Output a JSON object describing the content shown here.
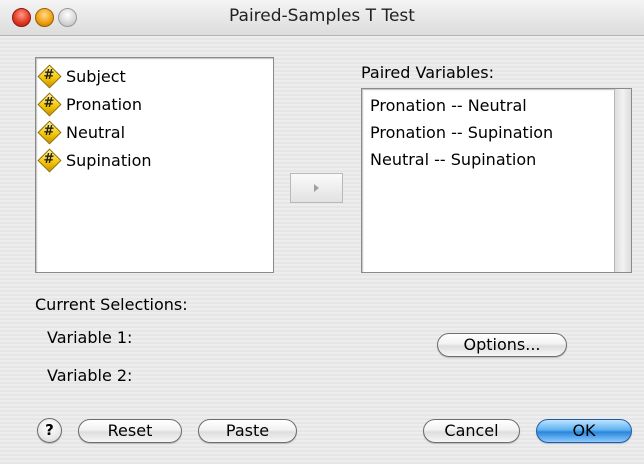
{
  "window": {
    "title": "Paired-Samples T Test"
  },
  "source_variables": [
    {
      "label": "Subject",
      "icon": "scale-variable-icon"
    },
    {
      "label": "Pronation",
      "icon": "scale-variable-icon"
    },
    {
      "label": "Neutral",
      "icon": "scale-variable-icon"
    },
    {
      "label": "Supination",
      "icon": "scale-variable-icon"
    }
  ],
  "paired": {
    "header": "Paired Variables:",
    "items": [
      "Pronation -- Neutral",
      "Pronation -- Supination",
      "Neutral -- Supination"
    ]
  },
  "current": {
    "header": "Current Selections:",
    "var1_label": "Variable 1:",
    "var2_label": "Variable 2:"
  },
  "buttons": {
    "help": "?",
    "options": "Options...",
    "reset": "Reset",
    "paste": "Paste",
    "cancel": "Cancel",
    "ok": "OK"
  },
  "icon_glyph": "#",
  "colors": {
    "accent": "#2b86d9",
    "variable_icon": "#f5c400"
  }
}
